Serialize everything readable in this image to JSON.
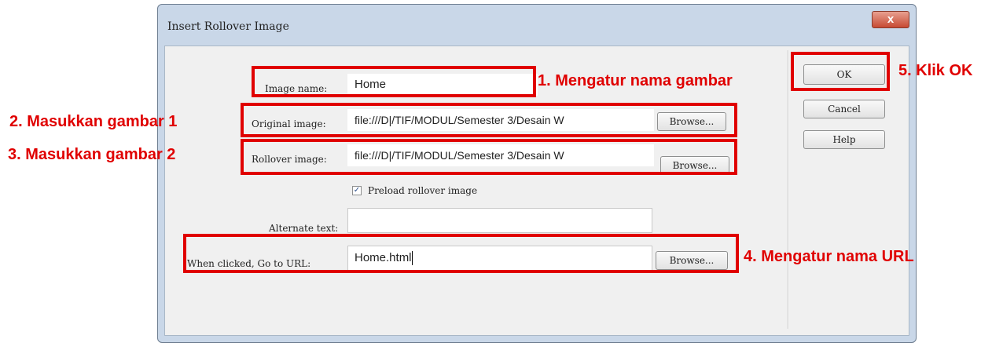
{
  "dialog": {
    "title": "Insert Rollover Image",
    "close_glyph": "x"
  },
  "fields": {
    "image_name": {
      "label": "Image name:",
      "value": "Home"
    },
    "original_image": {
      "label": "Original image:",
      "value": "file:///D|/TIF/MODUL/Semester 3/Desain W",
      "button": "Browse..."
    },
    "rollover_image": {
      "label": "Rollover image:",
      "value": "file:///D|/TIF/MODUL/Semester 3/Desain W",
      "button": "Browse..."
    },
    "preload": {
      "label": "Preload rollover image",
      "checked": true,
      "check_glyph": "✓"
    },
    "alternate_text": {
      "label": "Alternate text:",
      "value": ""
    },
    "go_to_url": {
      "label": "When clicked, Go to URL:",
      "value": "Home.html",
      "button": "Browse..."
    }
  },
  "buttons": {
    "ok": "OK",
    "cancel": "Cancel",
    "help": "Help"
  },
  "annotations": {
    "step1": "1. Mengatur nama gambar",
    "step2": "2. Masukkan gambar 1",
    "step3": "3. Masukkan gambar 2",
    "step4": "4. Mengatur nama URL",
    "step5": "5. Klik OK"
  },
  "colors": {
    "annotation": "#e00000",
    "dialog_frame": "#c9d7e8",
    "client_area": "#f0f0f0"
  }
}
